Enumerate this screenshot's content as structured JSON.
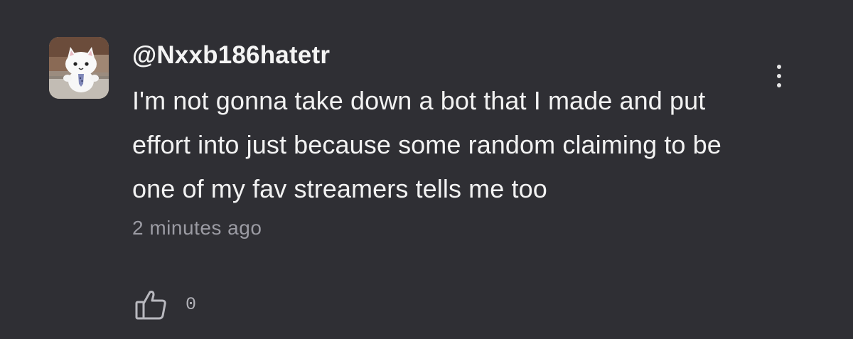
{
  "comment": {
    "username": "@Nxxb186hatetr",
    "text": "I'm not gonna take down a bot that I made and put effort into just because some random claiming to be one of my fav streamers tells me too",
    "timestamp": "2 minutes ago",
    "like_count": "0",
    "avatar_icon": "cat-avatar-icon",
    "like_icon": "thumbs-up-icon",
    "menu_icon": "more-vertical-icon"
  },
  "colors": {
    "background": "#2f2f34",
    "text": "#f2f2f2",
    "timestamp": "#9b9ba3"
  }
}
